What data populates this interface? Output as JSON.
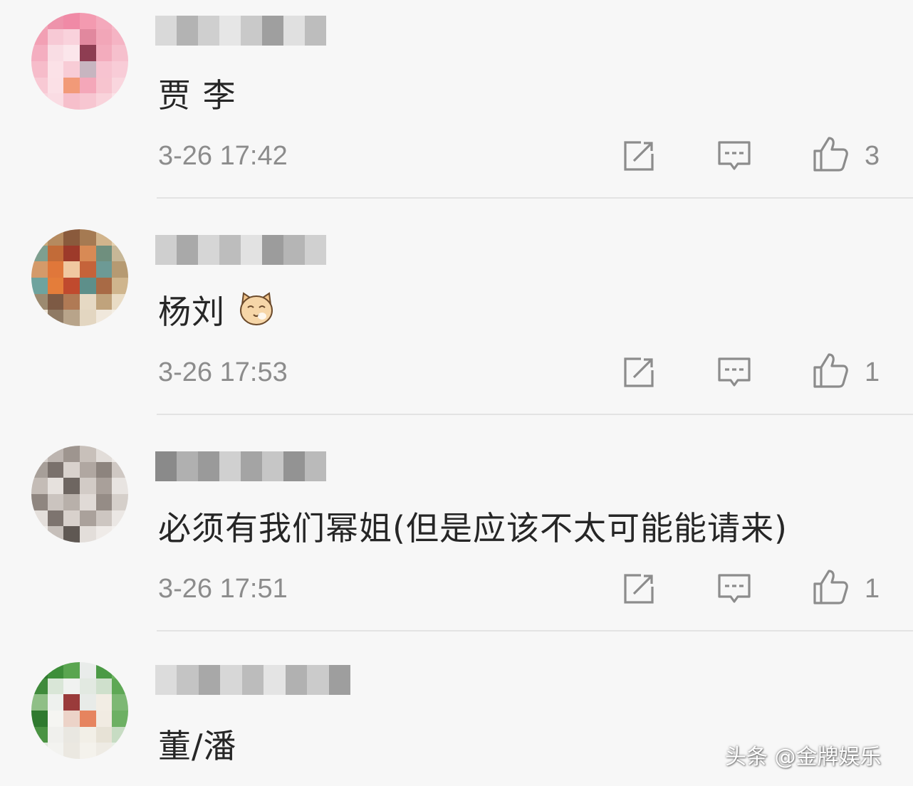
{
  "comments": [
    {
      "text": "贾 李",
      "time": "3-26 17:42",
      "likes": "3"
    },
    {
      "text": "杨刘",
      "time": "3-26 17:53",
      "likes": "1"
    },
    {
      "text": "必须有我们幂姐(但是应该不太可能能请来)",
      "time": "3-26 17:51",
      "likes": "1"
    },
    {
      "text": "董/潘"
    }
  ],
  "icons": {
    "share": "share-icon",
    "reply": "reply-icon",
    "like": "thumbs-up-icon",
    "emoji": "cat-emoji-icon"
  },
  "colors": {
    "background": "#f7f7f7",
    "text": "#262626",
    "meta": "#8c8c8c",
    "divider": "#e3e3e3"
  },
  "watermark": "头条 @金牌娱乐"
}
